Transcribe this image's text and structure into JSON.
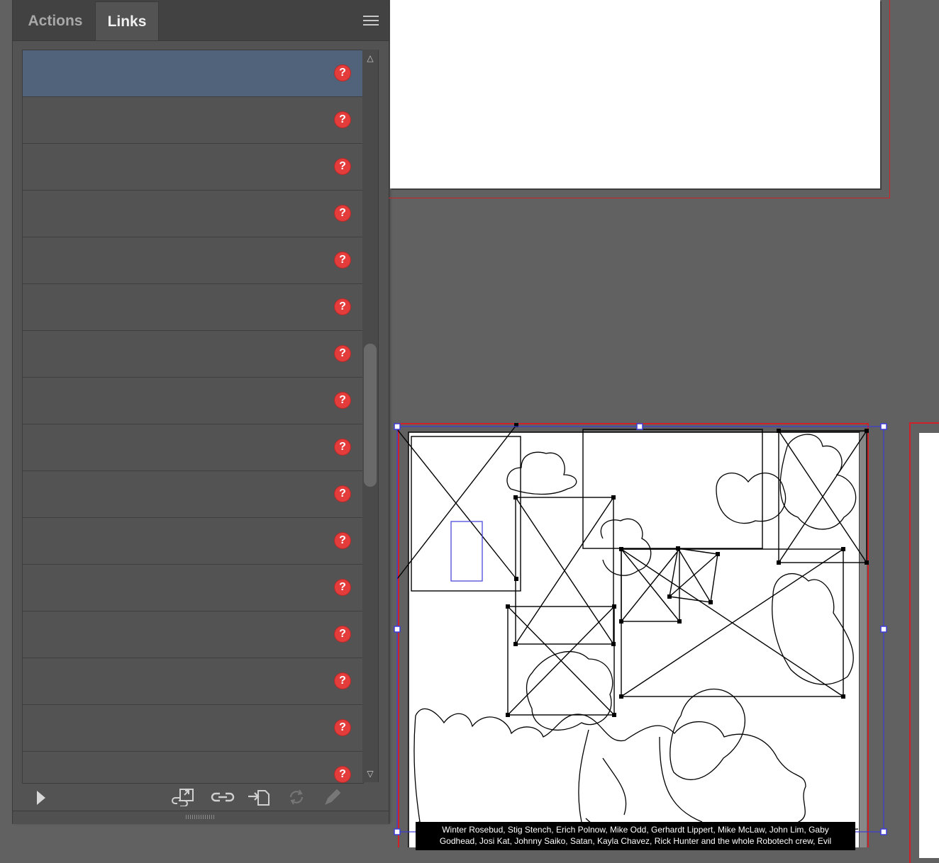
{
  "panel": {
    "tabs": [
      {
        "label": "Actions",
        "active": false
      },
      {
        "label": "Links",
        "active": true
      }
    ],
    "menu_icon": "hamburger-icon",
    "rows": [
      {
        "selected": true,
        "status": "?",
        "status_icon": "missing-link-icon"
      },
      {
        "selected": false,
        "status": "?",
        "status_icon": "missing-link-icon"
      },
      {
        "selected": false,
        "status": "?",
        "status_icon": "missing-link-icon"
      },
      {
        "selected": false,
        "status": "?",
        "status_icon": "missing-link-icon"
      },
      {
        "selected": false,
        "status": "?",
        "status_icon": "missing-link-icon"
      },
      {
        "selected": false,
        "status": "?",
        "status_icon": "missing-link-icon"
      },
      {
        "selected": false,
        "status": "?",
        "status_icon": "missing-link-icon"
      },
      {
        "selected": false,
        "status": "?",
        "status_icon": "missing-link-icon"
      },
      {
        "selected": false,
        "status": "?",
        "status_icon": "missing-link-icon"
      },
      {
        "selected": false,
        "status": "?",
        "status_icon": "missing-link-icon"
      },
      {
        "selected": false,
        "status": "?",
        "status_icon": "missing-link-icon"
      },
      {
        "selected": false,
        "status": "?",
        "status_icon": "missing-link-icon"
      },
      {
        "selected": false,
        "status": "?",
        "status_icon": "missing-link-icon"
      },
      {
        "selected": false,
        "status": "?",
        "status_icon": "missing-link-icon"
      },
      {
        "selected": false,
        "status": "?",
        "status_icon": "missing-link-icon"
      },
      {
        "selected": false,
        "status": "?",
        "status_icon": "missing-link-icon"
      }
    ],
    "footer_icons": [
      "play-icon",
      "relink-from-library-icon",
      "relink-icon",
      "go-to-link-icon",
      "update-link-icon",
      "edit-original-icon"
    ]
  },
  "canvas": {
    "credits_line1": "Winter Rosebud, Stig Stench, Erich Polnow, Mike Odd, Gerhardt Lippert, Mike McLaw, John Lim, Gaby",
    "credits_line2": "Godhead, Josi Kat, Johnny Saiko, Satan, Kayla Chavez, Rick Hunter and the whole Robotech crew, Evil"
  },
  "colors": {
    "selection": "#51637a",
    "missing": "#e43b3b",
    "bleed": "#d0202a",
    "bounding_box": "#3d3dd6"
  }
}
